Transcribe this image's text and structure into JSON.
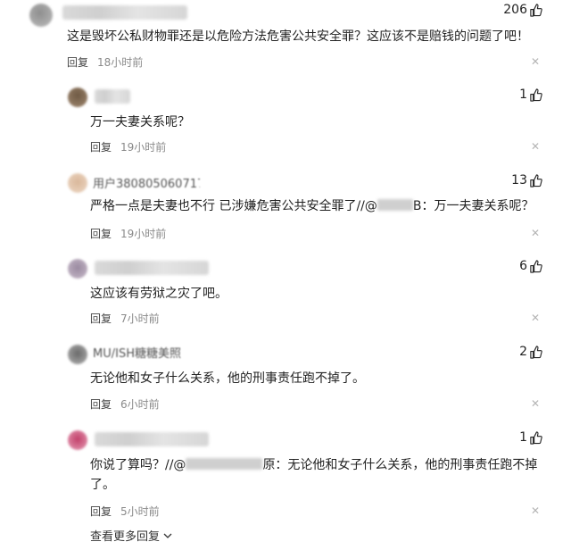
{
  "comments": [
    {
      "text": "这是毁坏公私财物罪还是以危险方法危害公共安全罪？这应该不是赔钱的问题了吧！",
      "likes": "206",
      "reply": "回复",
      "time": "18小时前"
    },
    {
      "text": "万一夫妻关系呢？",
      "likes": "1",
      "reply": "回复",
      "time": "19小时前"
    },
    {
      "name": "用户380805060717",
      "text": "严格一点是夫妻也不行 已涉嫌危害公共安全罪了//@",
      "text_tail": "B：万一夫妻关系呢？",
      "likes": "13",
      "reply": "回复",
      "time": "19小时前"
    },
    {
      "text": "这应该有劳狱之灾了吧。",
      "likes": "6",
      "reply": "回复",
      "time": "7小时前"
    },
    {
      "name": "MU/ISH糖糖美照",
      "text": "无论他和女子什么关系，他的刑事责任跑不掉了。",
      "likes": "2",
      "reply": "回复",
      "time": "6小时前"
    },
    {
      "text": "你说了算吗？//@",
      "text_tail": "原：无论他和女子什么关系，他的刑事责任跑不掉",
      "text_line2": "了。",
      "likes": "1",
      "reply": "回复",
      "time": "5小时前"
    }
  ],
  "footer": {
    "more_replies": "查看更多回复"
  },
  "icons": {
    "like": "thumbs-up-icon",
    "close": "close-icon",
    "expand": "chevron-down-icon"
  }
}
